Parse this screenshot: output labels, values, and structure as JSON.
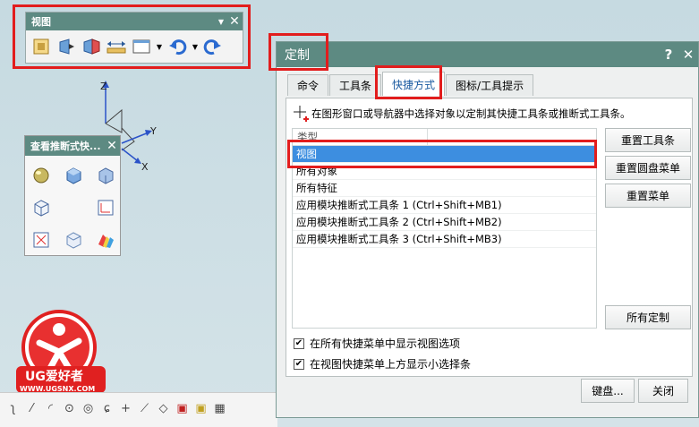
{
  "view_toolbar": {
    "title": "视图",
    "icons": [
      "fit-view-icon",
      "section-view-icon",
      "clip-section-icon",
      "measure-ruler-icon",
      "layout-icon",
      "undo-icon",
      "redo-icon"
    ]
  },
  "quick_panel": {
    "title": "查看推断式快..."
  },
  "axes": {
    "z": "Z",
    "y": "Y",
    "x": "X"
  },
  "logo": {
    "brand": "UG爱好者",
    "url": "WWW.UGSNX.COM"
  },
  "dialog": {
    "title": "定制",
    "help": "?",
    "close": "✕",
    "tabs": [
      "命令",
      "工具条",
      "快捷方式",
      "图标/工具提示"
    ],
    "active_tab": "快捷方式",
    "hint": "在图形窗口或导航器中选择对象以定制其快捷工具条或推断式工具条。",
    "list_header": "类型",
    "rows": [
      "视图",
      "所有对象",
      "所有特征",
      "应用模块推断式工具条 1 (Ctrl+Shift+MB1)",
      "应用模块推断式工具条 2 (Ctrl+Shift+MB2)",
      "应用模块推断式工具条 3 (Ctrl+Shift+MB3)"
    ],
    "selected_row": "视图",
    "buttons": {
      "reset_toolbar": "重置工具条",
      "reset_radial": "重置圆盘菜单",
      "reset_menu": "重置菜单",
      "customize_all": "所有定制",
      "keyboard": "键盘...",
      "close": "关闭"
    },
    "checkboxes": [
      {
        "label": "在所有快捷菜单中显示视图选项",
        "checked": true
      },
      {
        "label": "在视图快捷菜单上方显示小选择条",
        "checked": true
      }
    ]
  },
  "colors": {
    "title_bar": "#5d8a82",
    "highlight": "#e21d1d",
    "selection": "#3d8ee0"
  }
}
